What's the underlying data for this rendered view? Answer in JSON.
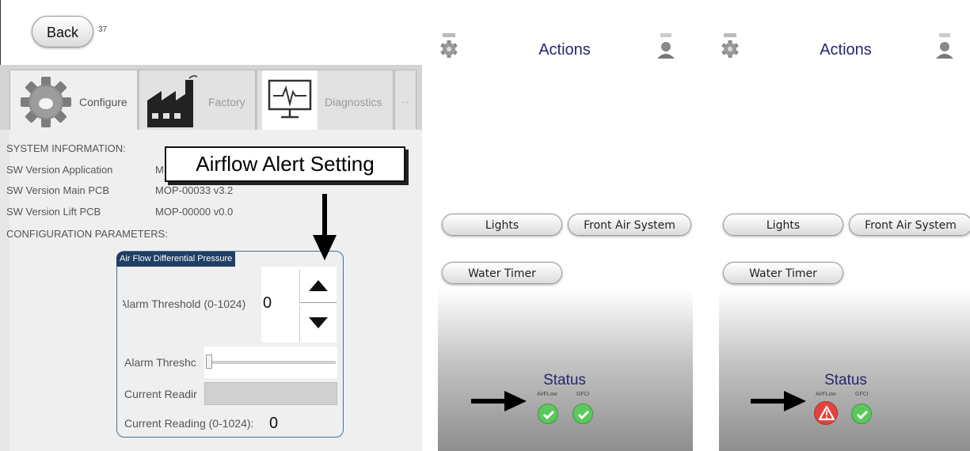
{
  "left_panel": {
    "back_label": "Back",
    "page_number": "37",
    "tabs": [
      {
        "label": "Configure",
        "icon": "gear-icon"
      },
      {
        "label": "Factory",
        "icon": "factory-icon"
      },
      {
        "label": "Diagnostics",
        "icon": "monitor-pulse-icon"
      },
      {
        "label": "..."
      }
    ],
    "system_info_heading": "SYSTEM INFORMATION:",
    "rows": [
      {
        "label": "SW Version Application",
        "value": "M"
      },
      {
        "label": "SW Version Main PCB",
        "value": "MOP-00033 v3.2"
      },
      {
        "label": "SW Version Lift PCB",
        "value": "MOP-00000 v0.0"
      }
    ],
    "config_heading": "CONFIGURATION PARAMETERS:",
    "group": {
      "title": "Air Flow Differential Pressure",
      "alarm_threshold_label": "Alarm Threshold (0-1024)",
      "alarm_threshold_value": "0",
      "alarm_slider_label": "Alarm Threshc",
      "alarm_slider_value": 0,
      "current_reading_slider_label": "Current Readir",
      "current_reading_label": "Current Reading (0-1024):",
      "current_reading_value": "0"
    },
    "callout": "Airflow Alert Setting"
  },
  "phones": [
    {
      "header_title": "Actions",
      "buttons": {
        "lights": "Lights",
        "front_air": "Front Air System",
        "water_timer": "Water Timer"
      },
      "status_title": "Status",
      "indicators": [
        {
          "label": "AirFLow",
          "state": "ok",
          "color": "#5bc85d"
        },
        {
          "label": "GFCI",
          "state": "ok",
          "color": "#5bc85d"
        }
      ]
    },
    {
      "header_title": "Actions",
      "buttons": {
        "lights": "Lights",
        "front_air": "Front Air System",
        "water_timer": "Water Timer"
      },
      "status_title": "Status",
      "indicators": [
        {
          "label": "AirFLow",
          "state": "warning",
          "color": "#e2433e"
        },
        {
          "label": "GFCI",
          "state": "ok",
          "color": "#5bc85d"
        }
      ]
    }
  ],
  "colors": {
    "title_text": "#27266d",
    "group_title_bg": "#1f3f65",
    "ok": "#5bc85d",
    "warning": "#e2433e"
  }
}
